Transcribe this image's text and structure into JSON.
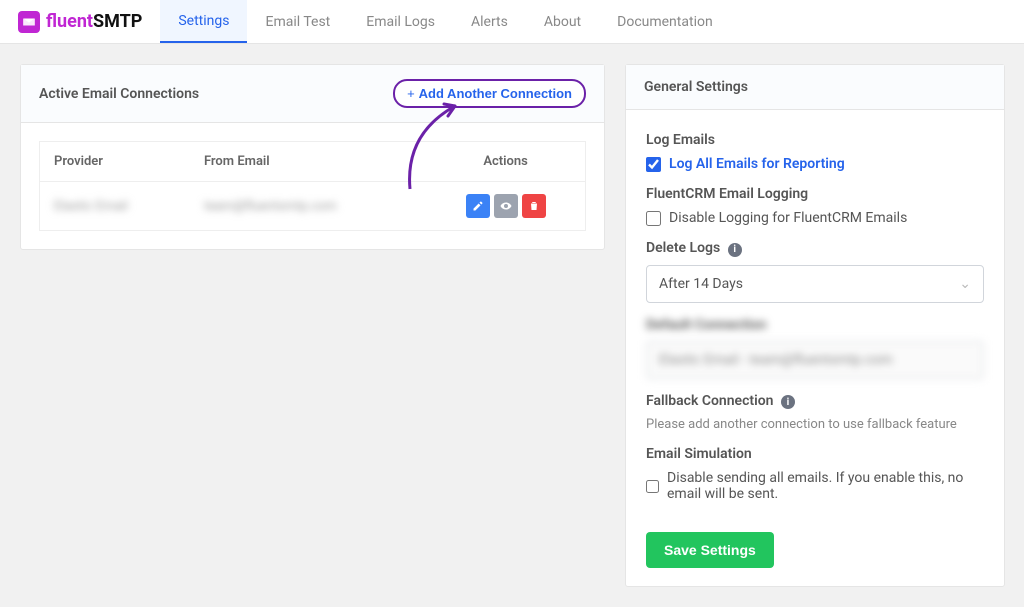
{
  "brand": {
    "fl": "fluent",
    "smtp": "SMTP"
  },
  "tabs": {
    "settings": "Settings",
    "email_test": "Email Test",
    "email_logs": "Email Logs",
    "alerts": "Alerts",
    "about": "About",
    "documentation": "Documentation"
  },
  "connections": {
    "title": "Active Email Connections",
    "add_label": "Add Another Connection",
    "cols": {
      "provider": "Provider",
      "from": "From Email",
      "actions": "Actions"
    },
    "row": {
      "provider": "Elastic Email",
      "from": "team@fluentsmtp.com"
    }
  },
  "general": {
    "title": "General Settings",
    "log_emails_label": "Log Emails",
    "log_all": "Log All Emails for Reporting",
    "fluentcrm_label": "FluentCRM Email Logging",
    "disable_fluentcrm": "Disable Logging for FluentCRM Emails",
    "delete_logs_label": "Delete Logs",
    "delete_logs_value": "After 14 Days",
    "default_conn_label": "Default Connection",
    "default_conn_value": "Elastic Email - team@fluentsmtp.com",
    "fallback_label": "Fallback Connection",
    "fallback_help": "Please add another connection to use fallback feature",
    "simulation_label": "Email Simulation",
    "simulation_check": "Disable sending all emails. If you enable this, no email will be sent.",
    "save": "Save Settings"
  }
}
